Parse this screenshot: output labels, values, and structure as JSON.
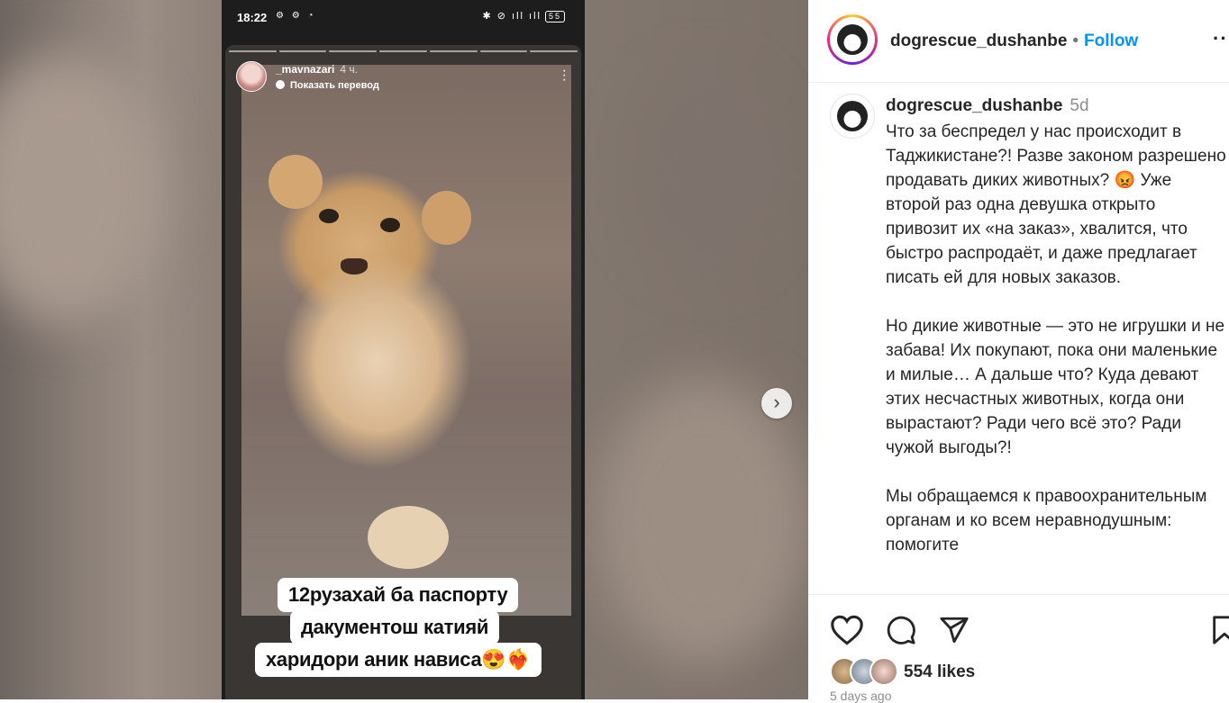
{
  "status_bar": {
    "time": "18:22",
    "left_icons": "⚙ ⚙ ◔",
    "right_icons": "✱ ⊘ ıll ıll",
    "battery": "55"
  },
  "story": {
    "username": "_mavnazari",
    "time_ago": "4 ч.",
    "translate_label": "Показать перевод",
    "caption_lines": [
      "12рузахай ба паспорту",
      "дакументош катияй",
      "харидори аник нависа😍❤️‍🔥"
    ],
    "segments": 7
  },
  "post": {
    "author": "dogrescue_dushanbe",
    "follow_label": "Follow",
    "dot": "•",
    "caption_author": "dogrescue_dushanbe",
    "caption_age": "5d",
    "caption_paragraphs": [
      "Что за беспредел у нас происходит в Таджикистане?! Разве законом разрешено продавать диких животных? 😡 Уже второй раз одна девушка открыто привозит их «на заказ», хвалится, что быстро распродаёт, и даже предлагает писать ей для новых заказов.",
      "Но дикие животные — это не игрушки и не забава! Их покупают, пока они маленькие и милые… А дальше что? Куда девают этих несчастных животных, когда они вырастают? Ради чего всё это? Ради чужой выгоды?!",
      "Мы обращаемся к правоохранительным органам и ко всем неравнодушным: помогите"
    ],
    "likes": "554 likes",
    "date": "5 days ago"
  },
  "icons": {
    "next": "chevron-right-icon",
    "more": "more-options-icon",
    "like": "heart-icon",
    "comment": "comment-icon",
    "share": "share-icon",
    "save": "bookmark-icon"
  },
  "colors": {
    "follow_blue": "#0095f6",
    "text": "#262626",
    "muted": "#8e8e8e"
  }
}
